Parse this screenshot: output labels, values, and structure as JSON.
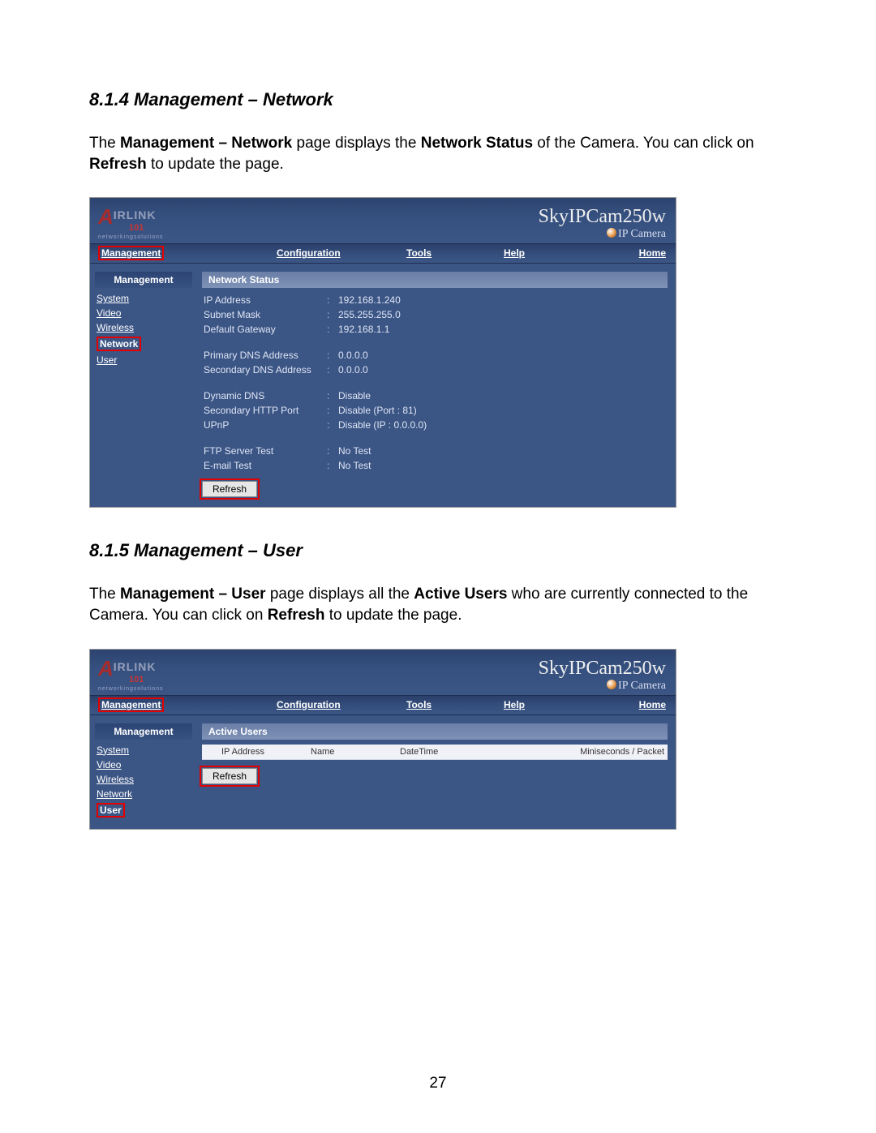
{
  "doc": {
    "section1_heading": "8.1.4 Management – Network",
    "section1_para_pre": "The ",
    "section1_para_b1": "Management – Network",
    "section1_para_mid1": " page displays the ",
    "section1_para_b2": "Network Status",
    "section1_para_mid2": " of the Camera. You can click on ",
    "section1_para_b3": "Refresh",
    "section1_para_post": " to update the page.",
    "section2_heading": "8.1.5 Management – User",
    "section2_para_pre": "The ",
    "section2_para_b1": "Management – User",
    "section2_para_mid1": " page displays all the ",
    "section2_para_b2": "Active Users",
    "section2_para_mid2": " who are currently connected to the Camera. You can click on ",
    "section2_para_b3": "Refresh",
    "section2_para_post": " to update the page.",
    "page_number": "27"
  },
  "logo": {
    "a": "A",
    "irlink": "IRLINK",
    "n101": "101",
    "tagline": "networkingsolutions"
  },
  "product": {
    "name": "SkyIPCam250w",
    "sub": "IP Camera"
  },
  "topnav": {
    "management": "Management",
    "configuration": "Configuration",
    "tools": "Tools",
    "help": "Help",
    "home": "Home"
  },
  "sidebar": {
    "head": "Management",
    "system": "System",
    "video": "Video",
    "wireless": "Wireless",
    "network": "Network",
    "user": "User"
  },
  "network_panel": {
    "title": "Network Status",
    "rows": [
      {
        "k": "IP Address",
        "v": "192.168.1.240"
      },
      {
        "k": "Subnet Mask",
        "v": "255.255.255.0"
      },
      {
        "k": "Default Gateway",
        "v": "192.168.1.1"
      }
    ],
    "rows2": [
      {
        "k": "Primary DNS Address",
        "v": "0.0.0.0"
      },
      {
        "k": "Secondary DNS Address",
        "v": "0.0.0.0"
      }
    ],
    "rows3": [
      {
        "k": "Dynamic DNS",
        "v": "Disable"
      },
      {
        "k": "Secondary HTTP Port",
        "v": "Disable (Port : 81)"
      },
      {
        "k": "UPnP",
        "v": "Disable (IP : 0.0.0.0)"
      }
    ],
    "rows4": [
      {
        "k": "FTP Server Test",
        "v": "No Test"
      },
      {
        "k": "E-mail Test",
        "v": "No Test"
      }
    ],
    "refresh": "Refresh"
  },
  "user_panel": {
    "title": "Active Users",
    "cols": {
      "ip": "IP Address",
      "name": "Name",
      "datetime": "DateTime",
      "packet": "Miniseconds / Packet"
    },
    "refresh": "Refresh"
  }
}
